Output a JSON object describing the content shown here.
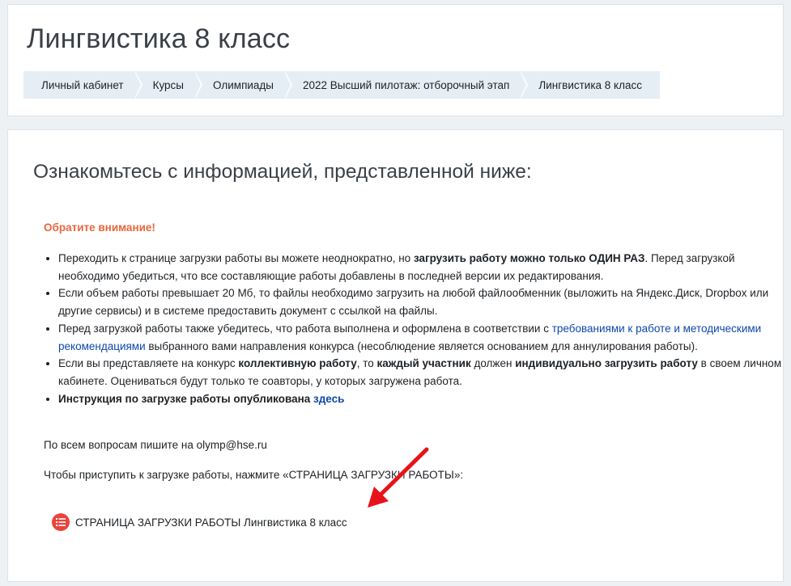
{
  "header": {
    "title": "Лингвистика 8 класс",
    "breadcrumbs": [
      {
        "label": "Личный кабинет"
      },
      {
        "label": "Курсы"
      },
      {
        "label": "Олимпиады"
      },
      {
        "label": "2022 Высший пилотаж: отборочный этап"
      },
      {
        "label": "Лингвистика 8 класс"
      }
    ]
  },
  "main": {
    "heading": "Ознакомьтесь с информацией, представленной ниже:",
    "notice": "Обратите внимание!",
    "rules": {
      "r1": {
        "a": "Переходить к странице загрузки работы вы можете неоднократно, но ",
        "b": "загрузить работу можно только ОДИН РАЗ",
        "c": ". Перед загрузкой необходимо убедиться, что все составляющие работы добавлены в последней версии их редактирования."
      },
      "r2": {
        "a": "Если объем работы превышает 20 Мб, то файлы необходимо загрузить на любой файлообменник (выложить на Яндекс.Диск, Dropbox или другие сервисы) и в системе предоставить документ с ссылкой на файлы."
      },
      "r3": {
        "a": "Перед загрузкой работы также убедитесь, что работа выполнена и оформлена в соответствии с ",
        "link": "требованиями к работе и методическими рекомендациями",
        "c": " выбранного вами направления конкурса (несоблюдение является основанием для аннулирования работы)."
      },
      "r4": {
        "a": "Если вы представляете на конкурс ",
        "b1": "коллективную работу",
        "c": ", то ",
        "b2": "каждый участник",
        "d": " должен ",
        "b3": "индивидуально загрузить работу",
        "e": " в своем личном кабинете. Оцениваться будут только те соавторы, у которых загружена работа."
      },
      "r5": {
        "b": "Инструкция по загрузке работы опубликована ",
        "link": "здесь"
      }
    },
    "contact": "По всем вопросам пишите на olymp@hse.ru",
    "start_hint": "Чтобы приступить к загрузке работы, нажмите «СТРАНИЦА ЗАГРУЗКИ РАБОТЫ»:",
    "upload_link": "СТРАНИЦА ЗАГРУЗКИ РАБОТЫ Лингвистика 8 класс"
  },
  "colors": {
    "accent_notice": "#e8663d",
    "link": "#0f47ad",
    "upload_icon": "#e8453c",
    "annotation_arrow": "#e8121a"
  },
  "icons": {
    "upload": "list-icon",
    "annotation": "red-arrow"
  }
}
